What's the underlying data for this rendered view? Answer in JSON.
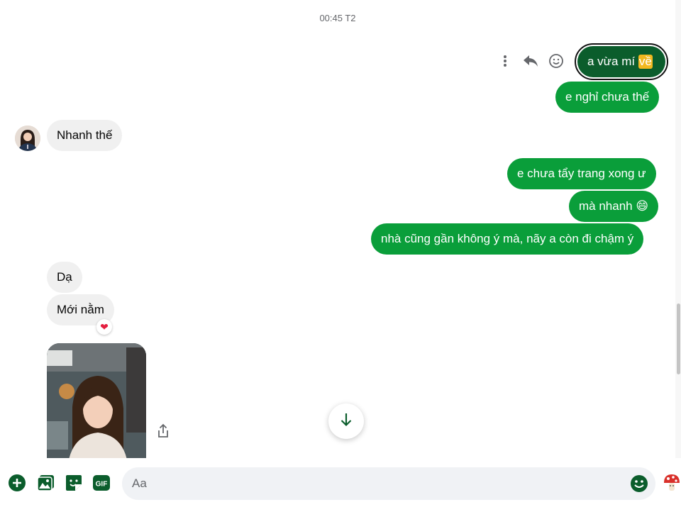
{
  "timestamp": "00:45 T2",
  "messages": {
    "selected": {
      "text": "a vừa mí ",
      "highlight": "về"
    },
    "out_1": "e nghỉ chưa thế",
    "in_1": "Nhanh thế",
    "out_2": "e chưa tẩy trang xong ư",
    "out_3": "mà nhanh 😄",
    "out_4": "nhà cũng gần không ý mà, nãy a còn đi chậm ý",
    "in_2": "Dạ",
    "in_3": "Mới nằm",
    "in_3_reaction": "❤"
  },
  "composer": {
    "placeholder": "Aa"
  },
  "icons": {
    "more": "more-vertical-icon",
    "reply": "reply-icon",
    "react": "smiley-icon",
    "share": "share-icon",
    "down": "arrow-down-icon",
    "plus": "plus-circle-icon",
    "image": "image-icon",
    "sticker": "sticker-icon",
    "gif": "gif-icon",
    "emoji": "emoji-icon",
    "quick_reaction": "mushroom-icon"
  },
  "colors": {
    "outgoing": "#0a9e3a",
    "selected": "#0b5d2c",
    "highlight": "#f2b81f",
    "incoming": "#f0f0f0",
    "accent": "#0b5d2c"
  }
}
